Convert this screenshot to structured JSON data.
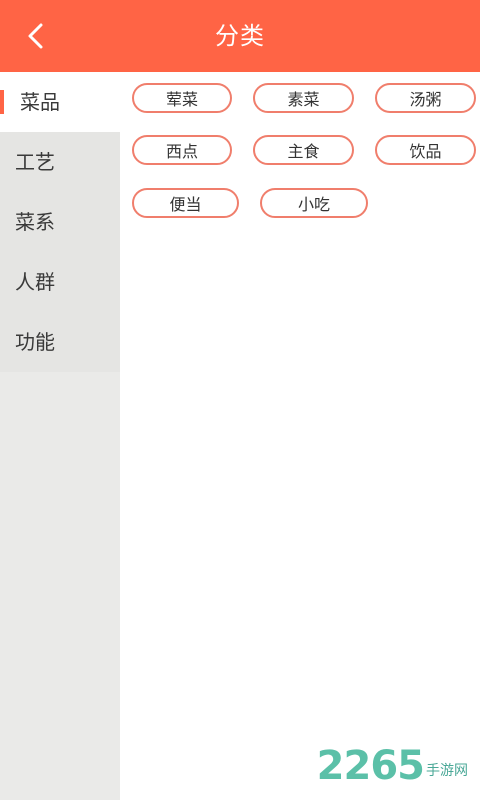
{
  "header": {
    "title": "分类",
    "back_icon": "chevron-left-icon"
  },
  "sidebar": {
    "items": [
      {
        "label": "菜品",
        "active": true
      },
      {
        "label": "工艺",
        "active": false
      },
      {
        "label": "菜系",
        "active": false
      },
      {
        "label": "人群",
        "active": false
      },
      {
        "label": "功能",
        "active": false
      }
    ]
  },
  "categories": {
    "chips": [
      {
        "label": "荤菜"
      },
      {
        "label": "素菜"
      },
      {
        "label": "汤粥"
      },
      {
        "label": "西点"
      },
      {
        "label": "主食"
      },
      {
        "label": "饮品"
      },
      {
        "label": "便当"
      },
      {
        "label": "小吃"
      }
    ]
  },
  "watermark": {
    "number": "2265",
    "text": "手游网"
  },
  "colors": {
    "accent": "#ff6445",
    "chip_border": "#f07e6c",
    "sidebar_bg": "#eaeae8"
  }
}
